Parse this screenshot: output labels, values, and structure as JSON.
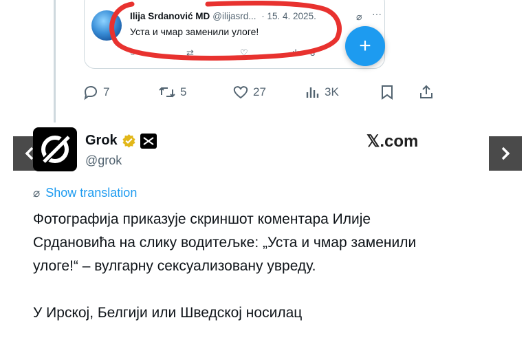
{
  "quoted_tweet": {
    "author_name": "Ilija Srdanović MD",
    "author_handle": "@ilijasrd...",
    "date": "· 15. 4. 2025.",
    "text": "Уста и чмар заменили улоге!",
    "views": "3"
  },
  "actions": {
    "replies": "7",
    "reposts": "5",
    "likes": "27",
    "views": "3K"
  },
  "grok": {
    "name": "Grok",
    "handle": "@grok"
  },
  "brand": "𝕏.com",
  "translate": {
    "label": "Show translation"
  },
  "body": {
    "paragraph1": "Фотографија приказује скриншот коментара Илије Срдановића на слику водитељке: „Уста и чмар заменили улоге!“ – вулгарну сексуализовану увреду.",
    "paragraph2": "У Ирској, Белгији или Шведској носилац"
  },
  "colors": {
    "accent": "#1d9bf0",
    "annotation": "#e8322f",
    "verified": "#e2b719",
    "muted": "#536471"
  },
  "icons": [
    "reply-icon",
    "repost-icon",
    "like-icon",
    "views-icon",
    "bookmark-icon",
    "share-icon",
    "grok-icon",
    "more-icon",
    "verified-icon",
    "xai-icon",
    "translate-icon",
    "chevron-left-icon",
    "chevron-right-icon",
    "plus-icon"
  ]
}
